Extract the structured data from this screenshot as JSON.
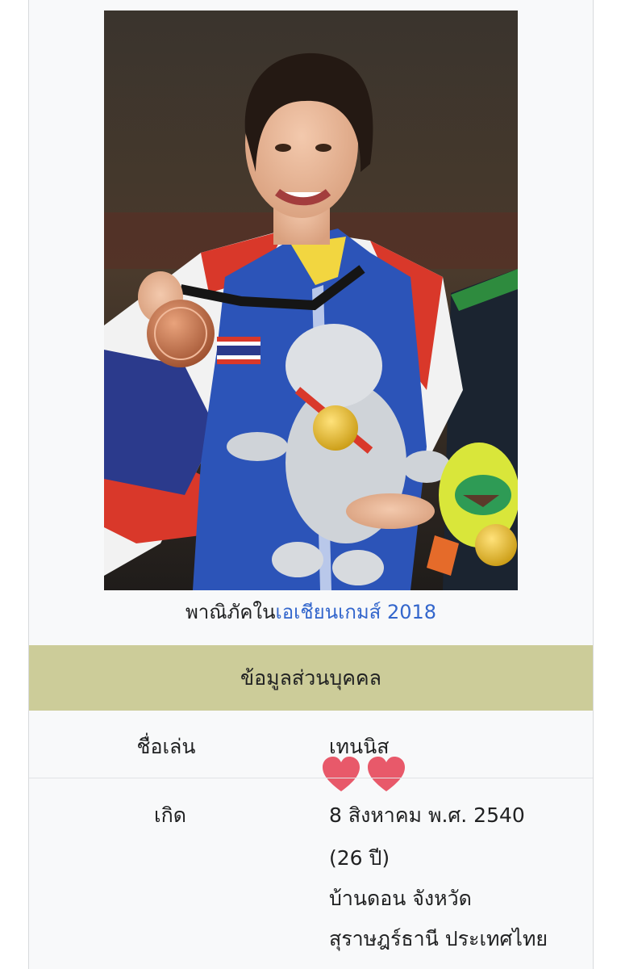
{
  "caption": {
    "prefix": "พาณิภัคใน",
    "link": "เอเชียนเกมส์ 2018"
  },
  "section_header": "ข้อมูลส่วนบุคคล",
  "rows": {
    "nickname": {
      "label": "ชื่อเล่น",
      "value": "เทนนิส"
    },
    "born": {
      "label": "เกิด",
      "date": "8 สิงหาคม พ.ศ. 2540",
      "age": "(26 ปี)",
      "place_line1": "บ้านดอน จังหวัด",
      "place_line2": "สุราษฎร์ธานี ประเทศไทย"
    }
  },
  "stickers": {
    "icon": "heart-icon",
    "count": 2,
    "color": "#e8596a"
  },
  "colors": {
    "header_bg": "#cccc99",
    "link": "#3366cc",
    "infobox_bg": "#f8f9fa"
  }
}
